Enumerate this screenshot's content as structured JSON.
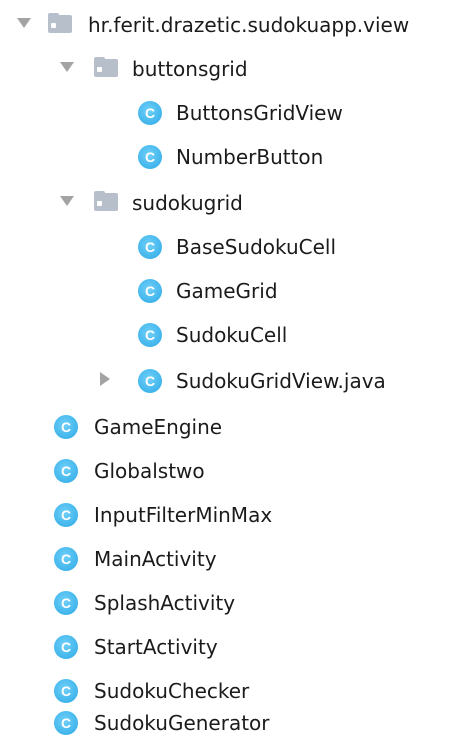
{
  "tree": {
    "root": {
      "label": "hr.ferit.drazetic.sudokuapp.view",
      "icon": "package-folder-icon",
      "expanded": true
    },
    "buttonsgrid": {
      "label": "buttonsgrid",
      "icon": "package-folder-icon",
      "expanded": true,
      "children": [
        "ButtonsGridView",
        "NumberButton"
      ]
    },
    "sudokugrid": {
      "label": "sudokugrid",
      "icon": "package-folder-icon",
      "expanded": true,
      "children": [
        "BaseSudokuCell",
        "GameGrid",
        "SudokuCell",
        "SudokuGridView.java"
      ]
    },
    "classes": [
      "GameEngine",
      "Globalstwo",
      "InputFilterMinMax",
      "MainActivity",
      "SplashActivity",
      "StartActivity",
      "SudokuChecker",
      "SudokuGenerator"
    ],
    "class_icon_letter": "C",
    "class_icon_color": "#40b4ec",
    "folder_icon_color": "#b7bfca",
    "arrow_color": "#a3a3a3"
  }
}
